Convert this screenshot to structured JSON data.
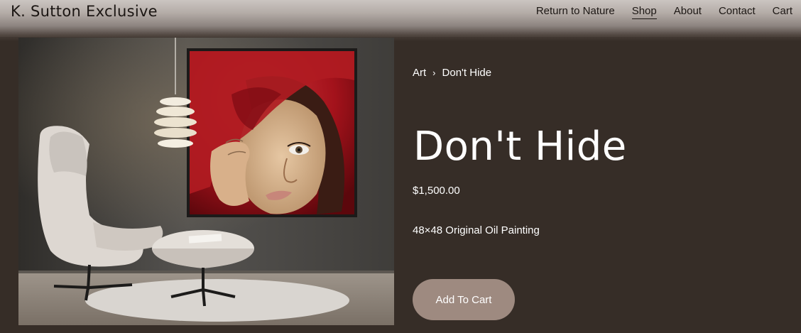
{
  "header": {
    "site_title": "K. Sutton Exclusive",
    "nav": [
      {
        "label": "Return to Nature",
        "active": false
      },
      {
        "label": "Shop",
        "active": true
      },
      {
        "label": "About",
        "active": false
      },
      {
        "label": "Contact",
        "active": false
      },
      {
        "label": "Cart",
        "active": false
      }
    ]
  },
  "product": {
    "breadcrumb": {
      "parent": "Art",
      "separator": "›",
      "current": "Don't Hide"
    },
    "title": "Don't Hide",
    "price": "$1,500.00",
    "description": "48×48 Original Oil Painting",
    "add_to_cart_label": "Add To Cart"
  },
  "colors": {
    "page_background": "#362d27",
    "button_background": "#9e8a80",
    "painting_red": "#a3121b"
  }
}
